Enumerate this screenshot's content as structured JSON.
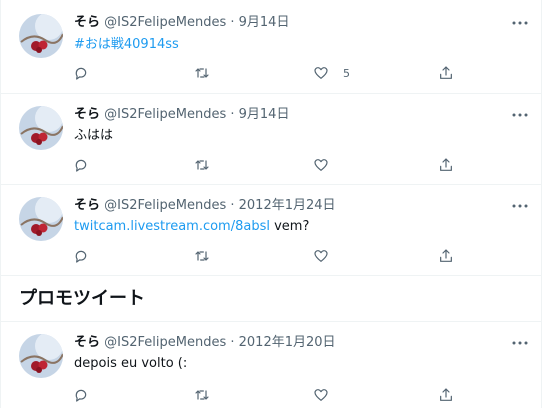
{
  "tweets": [
    {
      "name": "そら",
      "meta": "@IS2FelipeMendes · 9月14日",
      "text": "",
      "link": "#おは戦40914ss",
      "like_count": "5"
    },
    {
      "name": "そら",
      "meta": "@IS2FelipeMendes · 9月14日",
      "text": "ふはは",
      "link": "",
      "like_count": ""
    },
    {
      "name": "そら",
      "meta": "@IS2FelipeMendes · 2012年1月24日",
      "text": " vem?",
      "link": "twitcam.livestream.com/8absl",
      "like_count": ""
    },
    {
      "name": "そら",
      "meta": "@IS2FelipeMendes · 2012年1月20日",
      "text": "depois eu volto (:",
      "link": "",
      "like_count": ""
    }
  ],
  "promo_heading": "プロモツイート",
  "colors": {
    "link": "#1d9bf0",
    "muted": "#536471",
    "divider": "#eff3f4"
  },
  "icons": [
    "reply-icon",
    "retweet-icon",
    "like-icon",
    "share-icon",
    "more-icon"
  ]
}
